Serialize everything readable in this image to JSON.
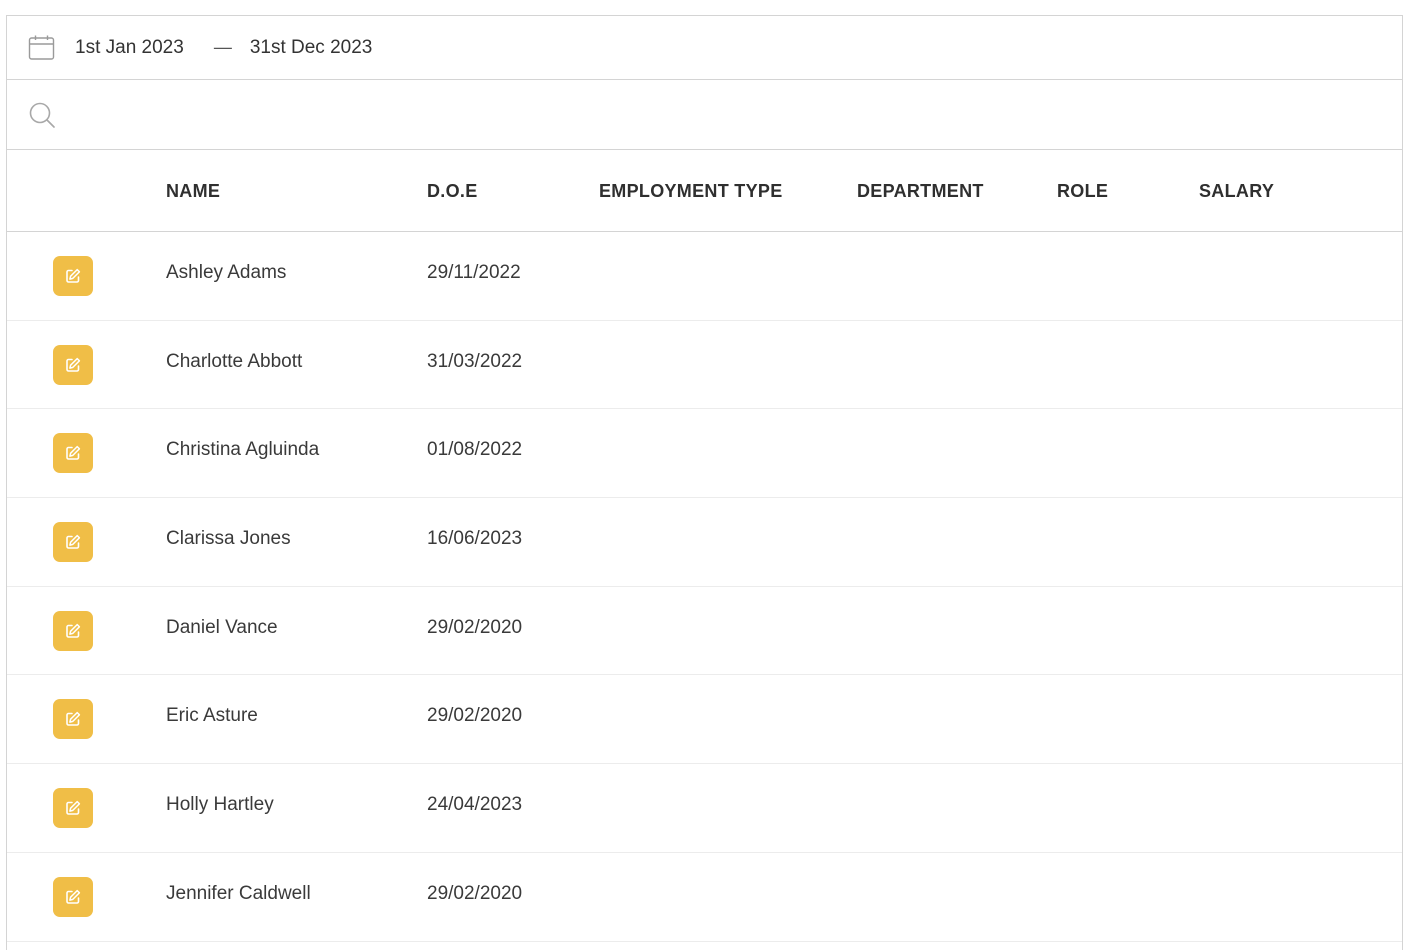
{
  "date_range": {
    "start": "1st Jan 2023",
    "separator": "—",
    "end": "31st Dec 2023",
    "icon": "calendar-icon"
  },
  "search": {
    "value": "",
    "placeholder": "",
    "icon": "search-icon"
  },
  "table": {
    "headers": {
      "name": "NAME",
      "doe": "D.O.E",
      "employment_type": "EMPLOYMENT TYPE",
      "department": "DEPARTMENT",
      "role": "ROLE",
      "salary": "SALARY"
    },
    "edit_icon": "edit-icon",
    "accent_color": "#f0be47",
    "rows": [
      {
        "name": "Ashley Adams",
        "doe": "29/11/2022",
        "employment_type": "",
        "department": "",
        "role": "",
        "salary": ""
      },
      {
        "name": "Charlotte Abbott",
        "doe": "31/03/2022",
        "employment_type": "",
        "department": "",
        "role": "",
        "salary": ""
      },
      {
        "name": "Christina Agluinda",
        "doe": "01/08/2022",
        "employment_type": "",
        "department": "",
        "role": "",
        "salary": ""
      },
      {
        "name": "Clarissa Jones",
        "doe": "16/06/2023",
        "employment_type": "",
        "department": "",
        "role": "",
        "salary": ""
      },
      {
        "name": "Daniel Vance",
        "doe": "29/02/2020",
        "employment_type": "",
        "department": "",
        "role": "",
        "salary": ""
      },
      {
        "name": "Eric Asture",
        "doe": "29/02/2020",
        "employment_type": "",
        "department": "",
        "role": "",
        "salary": ""
      },
      {
        "name": "Holly Hartley",
        "doe": "24/04/2023",
        "employment_type": "",
        "department": "",
        "role": "",
        "salary": ""
      },
      {
        "name": "Jennifer Caldwell",
        "doe": "29/02/2020",
        "employment_type": "",
        "department": "",
        "role": "",
        "salary": ""
      }
    ]
  }
}
